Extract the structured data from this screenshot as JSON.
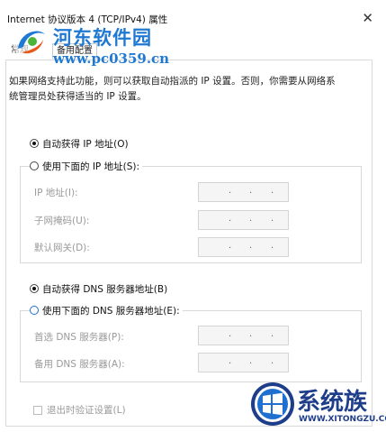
{
  "window": {
    "title": "Internet 协议版本 4 (TCP/IPv4) 属性",
    "close_icon": "close-icon"
  },
  "tabs": {
    "general": "常规",
    "alternate": "备用配置"
  },
  "description": "如果网络支持此功能，则可以获取自动指派的 IP 设置。否则，你需要从网络系统管理员处获得适当的 IP 设置。",
  "ip": {
    "auto_label": "自动获得 IP 地址(O)",
    "manual_label": "使用下面的 IP 地址(S):",
    "auto_selected": true,
    "fields": [
      {
        "label": "IP 地址(I):",
        "value": ". . ."
      },
      {
        "label": "子网掩码(U):",
        "value": ". . ."
      },
      {
        "label": "默认网关(D):",
        "value": ". . ."
      }
    ]
  },
  "dns": {
    "auto_label": "自动获得 DNS 服务器地址(B)",
    "manual_label": "使用下面的 DNS 服务器地址(E):",
    "auto_selected": true,
    "fields": [
      {
        "label": "首选 DNS 服务器(P):",
        "value": ". . ."
      },
      {
        "label": "备用 DNS 服务器(A):",
        "value": ". . ."
      }
    ]
  },
  "validate_label": "退出时验证设置(L)",
  "watermark_top": {
    "title": "河东软件园",
    "url": "www.pc0359.cn"
  },
  "watermark_bottom": {
    "title": "系统族",
    "url": "WWW.XITONGZU.COM"
  },
  "colors": {
    "watermark_blue": "#1f78d1",
    "watermark_navy": "#1f3e8a"
  }
}
